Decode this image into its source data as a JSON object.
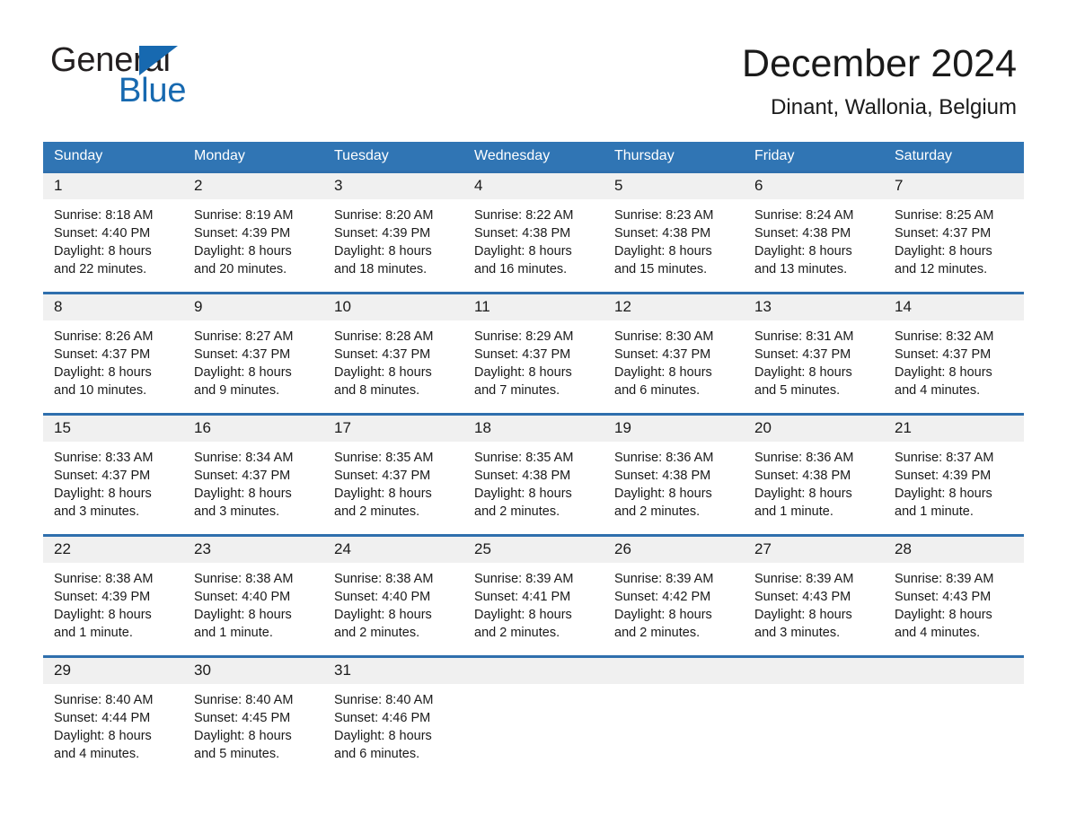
{
  "brand": {
    "name_part1": "General",
    "name_part2": "Blue",
    "triangle_color": "#1769b0"
  },
  "header": {
    "title": "December 2024",
    "subtitle": "Dinant, Wallonia, Belgium"
  },
  "theme": {
    "header_blue": "#3075b4",
    "row_border_blue": "#2f6fad",
    "daynum_band": "#f0f0f0",
    "text": "#1a1a1a"
  },
  "weekday_headers": [
    "Sunday",
    "Monday",
    "Tuesday",
    "Wednesday",
    "Thursday",
    "Friday",
    "Saturday"
  ],
  "labels": {
    "sunrise_prefix": "Sunrise: ",
    "sunset_prefix": "Sunset: ",
    "daylight_prefix": "Daylight: "
  },
  "weeks": [
    [
      {
        "day": "1",
        "sunrise": "Sunrise: 8:18 AM",
        "sunset": "Sunset: 4:40 PM",
        "daylight_line1": "Daylight: 8 hours",
        "daylight_line2": "and 22 minutes."
      },
      {
        "day": "2",
        "sunrise": "Sunrise: 8:19 AM",
        "sunset": "Sunset: 4:39 PM",
        "daylight_line1": "Daylight: 8 hours",
        "daylight_line2": "and 20 minutes."
      },
      {
        "day": "3",
        "sunrise": "Sunrise: 8:20 AM",
        "sunset": "Sunset: 4:39 PM",
        "daylight_line1": "Daylight: 8 hours",
        "daylight_line2": "and 18 minutes."
      },
      {
        "day": "4",
        "sunrise": "Sunrise: 8:22 AM",
        "sunset": "Sunset: 4:38 PM",
        "daylight_line1": "Daylight: 8 hours",
        "daylight_line2": "and 16 minutes."
      },
      {
        "day": "5",
        "sunrise": "Sunrise: 8:23 AM",
        "sunset": "Sunset: 4:38 PM",
        "daylight_line1": "Daylight: 8 hours",
        "daylight_line2": "and 15 minutes."
      },
      {
        "day": "6",
        "sunrise": "Sunrise: 8:24 AM",
        "sunset": "Sunset: 4:38 PM",
        "daylight_line1": "Daylight: 8 hours",
        "daylight_line2": "and 13 minutes."
      },
      {
        "day": "7",
        "sunrise": "Sunrise: 8:25 AM",
        "sunset": "Sunset: 4:37 PM",
        "daylight_line1": "Daylight: 8 hours",
        "daylight_line2": "and 12 minutes."
      }
    ],
    [
      {
        "day": "8",
        "sunrise": "Sunrise: 8:26 AM",
        "sunset": "Sunset: 4:37 PM",
        "daylight_line1": "Daylight: 8 hours",
        "daylight_line2": "and 10 minutes."
      },
      {
        "day": "9",
        "sunrise": "Sunrise: 8:27 AM",
        "sunset": "Sunset: 4:37 PM",
        "daylight_line1": "Daylight: 8 hours",
        "daylight_line2": "and 9 minutes."
      },
      {
        "day": "10",
        "sunrise": "Sunrise: 8:28 AM",
        "sunset": "Sunset: 4:37 PM",
        "daylight_line1": "Daylight: 8 hours",
        "daylight_line2": "and 8 minutes."
      },
      {
        "day": "11",
        "sunrise": "Sunrise: 8:29 AM",
        "sunset": "Sunset: 4:37 PM",
        "daylight_line1": "Daylight: 8 hours",
        "daylight_line2": "and 7 minutes."
      },
      {
        "day": "12",
        "sunrise": "Sunrise: 8:30 AM",
        "sunset": "Sunset: 4:37 PM",
        "daylight_line1": "Daylight: 8 hours",
        "daylight_line2": "and 6 minutes."
      },
      {
        "day": "13",
        "sunrise": "Sunrise: 8:31 AM",
        "sunset": "Sunset: 4:37 PM",
        "daylight_line1": "Daylight: 8 hours",
        "daylight_line2": "and 5 minutes."
      },
      {
        "day": "14",
        "sunrise": "Sunrise: 8:32 AM",
        "sunset": "Sunset: 4:37 PM",
        "daylight_line1": "Daylight: 8 hours",
        "daylight_line2": "and 4 minutes."
      }
    ],
    [
      {
        "day": "15",
        "sunrise": "Sunrise: 8:33 AM",
        "sunset": "Sunset: 4:37 PM",
        "daylight_line1": "Daylight: 8 hours",
        "daylight_line2": "and 3 minutes."
      },
      {
        "day": "16",
        "sunrise": "Sunrise: 8:34 AM",
        "sunset": "Sunset: 4:37 PM",
        "daylight_line1": "Daylight: 8 hours",
        "daylight_line2": "and 3 minutes."
      },
      {
        "day": "17",
        "sunrise": "Sunrise: 8:35 AM",
        "sunset": "Sunset: 4:37 PM",
        "daylight_line1": "Daylight: 8 hours",
        "daylight_line2": "and 2 minutes."
      },
      {
        "day": "18",
        "sunrise": "Sunrise: 8:35 AM",
        "sunset": "Sunset: 4:38 PM",
        "daylight_line1": "Daylight: 8 hours",
        "daylight_line2": "and 2 minutes."
      },
      {
        "day": "19",
        "sunrise": "Sunrise: 8:36 AM",
        "sunset": "Sunset: 4:38 PM",
        "daylight_line1": "Daylight: 8 hours",
        "daylight_line2": "and 2 minutes."
      },
      {
        "day": "20",
        "sunrise": "Sunrise: 8:36 AM",
        "sunset": "Sunset: 4:38 PM",
        "daylight_line1": "Daylight: 8 hours",
        "daylight_line2": "and 1 minute."
      },
      {
        "day": "21",
        "sunrise": "Sunrise: 8:37 AM",
        "sunset": "Sunset: 4:39 PM",
        "daylight_line1": "Daylight: 8 hours",
        "daylight_line2": "and 1 minute."
      }
    ],
    [
      {
        "day": "22",
        "sunrise": "Sunrise: 8:38 AM",
        "sunset": "Sunset: 4:39 PM",
        "daylight_line1": "Daylight: 8 hours",
        "daylight_line2": "and 1 minute."
      },
      {
        "day": "23",
        "sunrise": "Sunrise: 8:38 AM",
        "sunset": "Sunset: 4:40 PM",
        "daylight_line1": "Daylight: 8 hours",
        "daylight_line2": "and 1 minute."
      },
      {
        "day": "24",
        "sunrise": "Sunrise: 8:38 AM",
        "sunset": "Sunset: 4:40 PM",
        "daylight_line1": "Daylight: 8 hours",
        "daylight_line2": "and 2 minutes."
      },
      {
        "day": "25",
        "sunrise": "Sunrise: 8:39 AM",
        "sunset": "Sunset: 4:41 PM",
        "daylight_line1": "Daylight: 8 hours",
        "daylight_line2": "and 2 minutes."
      },
      {
        "day": "26",
        "sunrise": "Sunrise: 8:39 AM",
        "sunset": "Sunset: 4:42 PM",
        "daylight_line1": "Daylight: 8 hours",
        "daylight_line2": "and 2 minutes."
      },
      {
        "day": "27",
        "sunrise": "Sunrise: 8:39 AM",
        "sunset": "Sunset: 4:43 PM",
        "daylight_line1": "Daylight: 8 hours",
        "daylight_line2": "and 3 minutes."
      },
      {
        "day": "28",
        "sunrise": "Sunrise: 8:39 AM",
        "sunset": "Sunset: 4:43 PM",
        "daylight_line1": "Daylight: 8 hours",
        "daylight_line2": "and 4 minutes."
      }
    ],
    [
      {
        "day": "29",
        "sunrise": "Sunrise: 8:40 AM",
        "sunset": "Sunset: 4:44 PM",
        "daylight_line1": "Daylight: 8 hours",
        "daylight_line2": "and 4 minutes."
      },
      {
        "day": "30",
        "sunrise": "Sunrise: 8:40 AM",
        "sunset": "Sunset: 4:45 PM",
        "daylight_line1": "Daylight: 8 hours",
        "daylight_line2": "and 5 minutes."
      },
      {
        "day": "31",
        "sunrise": "Sunrise: 8:40 AM",
        "sunset": "Sunset: 4:46 PM",
        "daylight_line1": "Daylight: 8 hours",
        "daylight_line2": "and 6 minutes."
      },
      {
        "day": "",
        "sunrise": "",
        "sunset": "",
        "daylight_line1": "",
        "daylight_line2": ""
      },
      {
        "day": "",
        "sunrise": "",
        "sunset": "",
        "daylight_line1": "",
        "daylight_line2": ""
      },
      {
        "day": "",
        "sunrise": "",
        "sunset": "",
        "daylight_line1": "",
        "daylight_line2": ""
      },
      {
        "day": "",
        "sunrise": "",
        "sunset": "",
        "daylight_line1": "",
        "daylight_line2": ""
      }
    ]
  ]
}
